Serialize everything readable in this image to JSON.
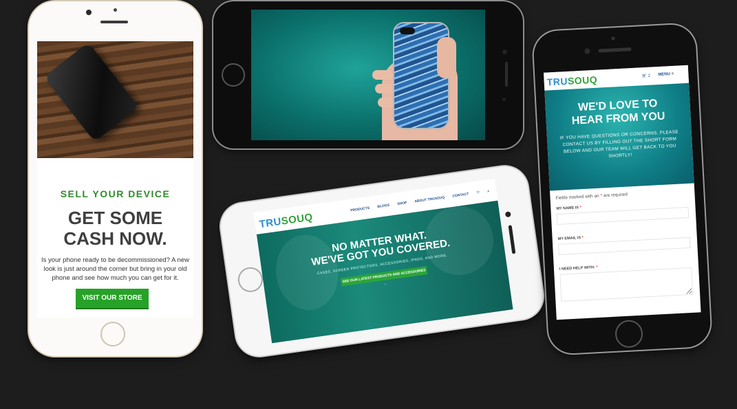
{
  "phone_left": {
    "eyebrow": "SELL YOUR DEVICE",
    "headline_line1": "GET SOME",
    "headline_line2": "CASH NOW.",
    "body": "Is your phone ready to be decommissioned? A new look is just around the corner but bring in your old phone and see how much you can get for it.",
    "cta": "VISIT OUR STORE"
  },
  "phone_tilted": {
    "logo_tru": "TRU",
    "logo_souq": "SOUQ",
    "nav": [
      "PRODUCTS",
      "BLOGS",
      "SHOP",
      "ABOUT TRUSOUQ",
      "CONTACT"
    ],
    "hero_line1": "NO MATTER WHAT.",
    "hero_line2": "WE'VE GOT YOU COVERED.",
    "hero_sub": "CASES, SCREEN PROTECTORS, ACCESSORIES, IPADS, AND MORE.",
    "hero_cta": "SEE OUR LATEST PRODUCTS AND ACCESSORIES →"
  },
  "phone_right": {
    "logo_tru": "TRU",
    "logo_souq": "SOUQ",
    "cart_count": "2",
    "menu_label": "MENU ≡",
    "hero_title_line1": "WE'D LOVE TO",
    "hero_title_line2": "HEAR FROM YOU",
    "hero_body": "IF YOU HAVE QUESTIONS OR CONCERNS, PLEASE CONTACT US BY FILLING OUT THE SHORT FORM BELOW AND OUR TEAM WILL GET BACK TO YOU SHORTLY!",
    "required_note_pre": "Fields marked with an",
    "required_note_post": "are required",
    "required_star": "*",
    "label_name": "MY NAME IS",
    "label_email": "MY EMAIL IS",
    "label_help": "I NEED HELP WITH:"
  },
  "colors": {
    "brand_green": "#2f8c2c",
    "button_green": "#27a228",
    "brand_blue": "#2a8fd1",
    "nav_blue": "#27528b",
    "teal": "#0f7e86"
  }
}
